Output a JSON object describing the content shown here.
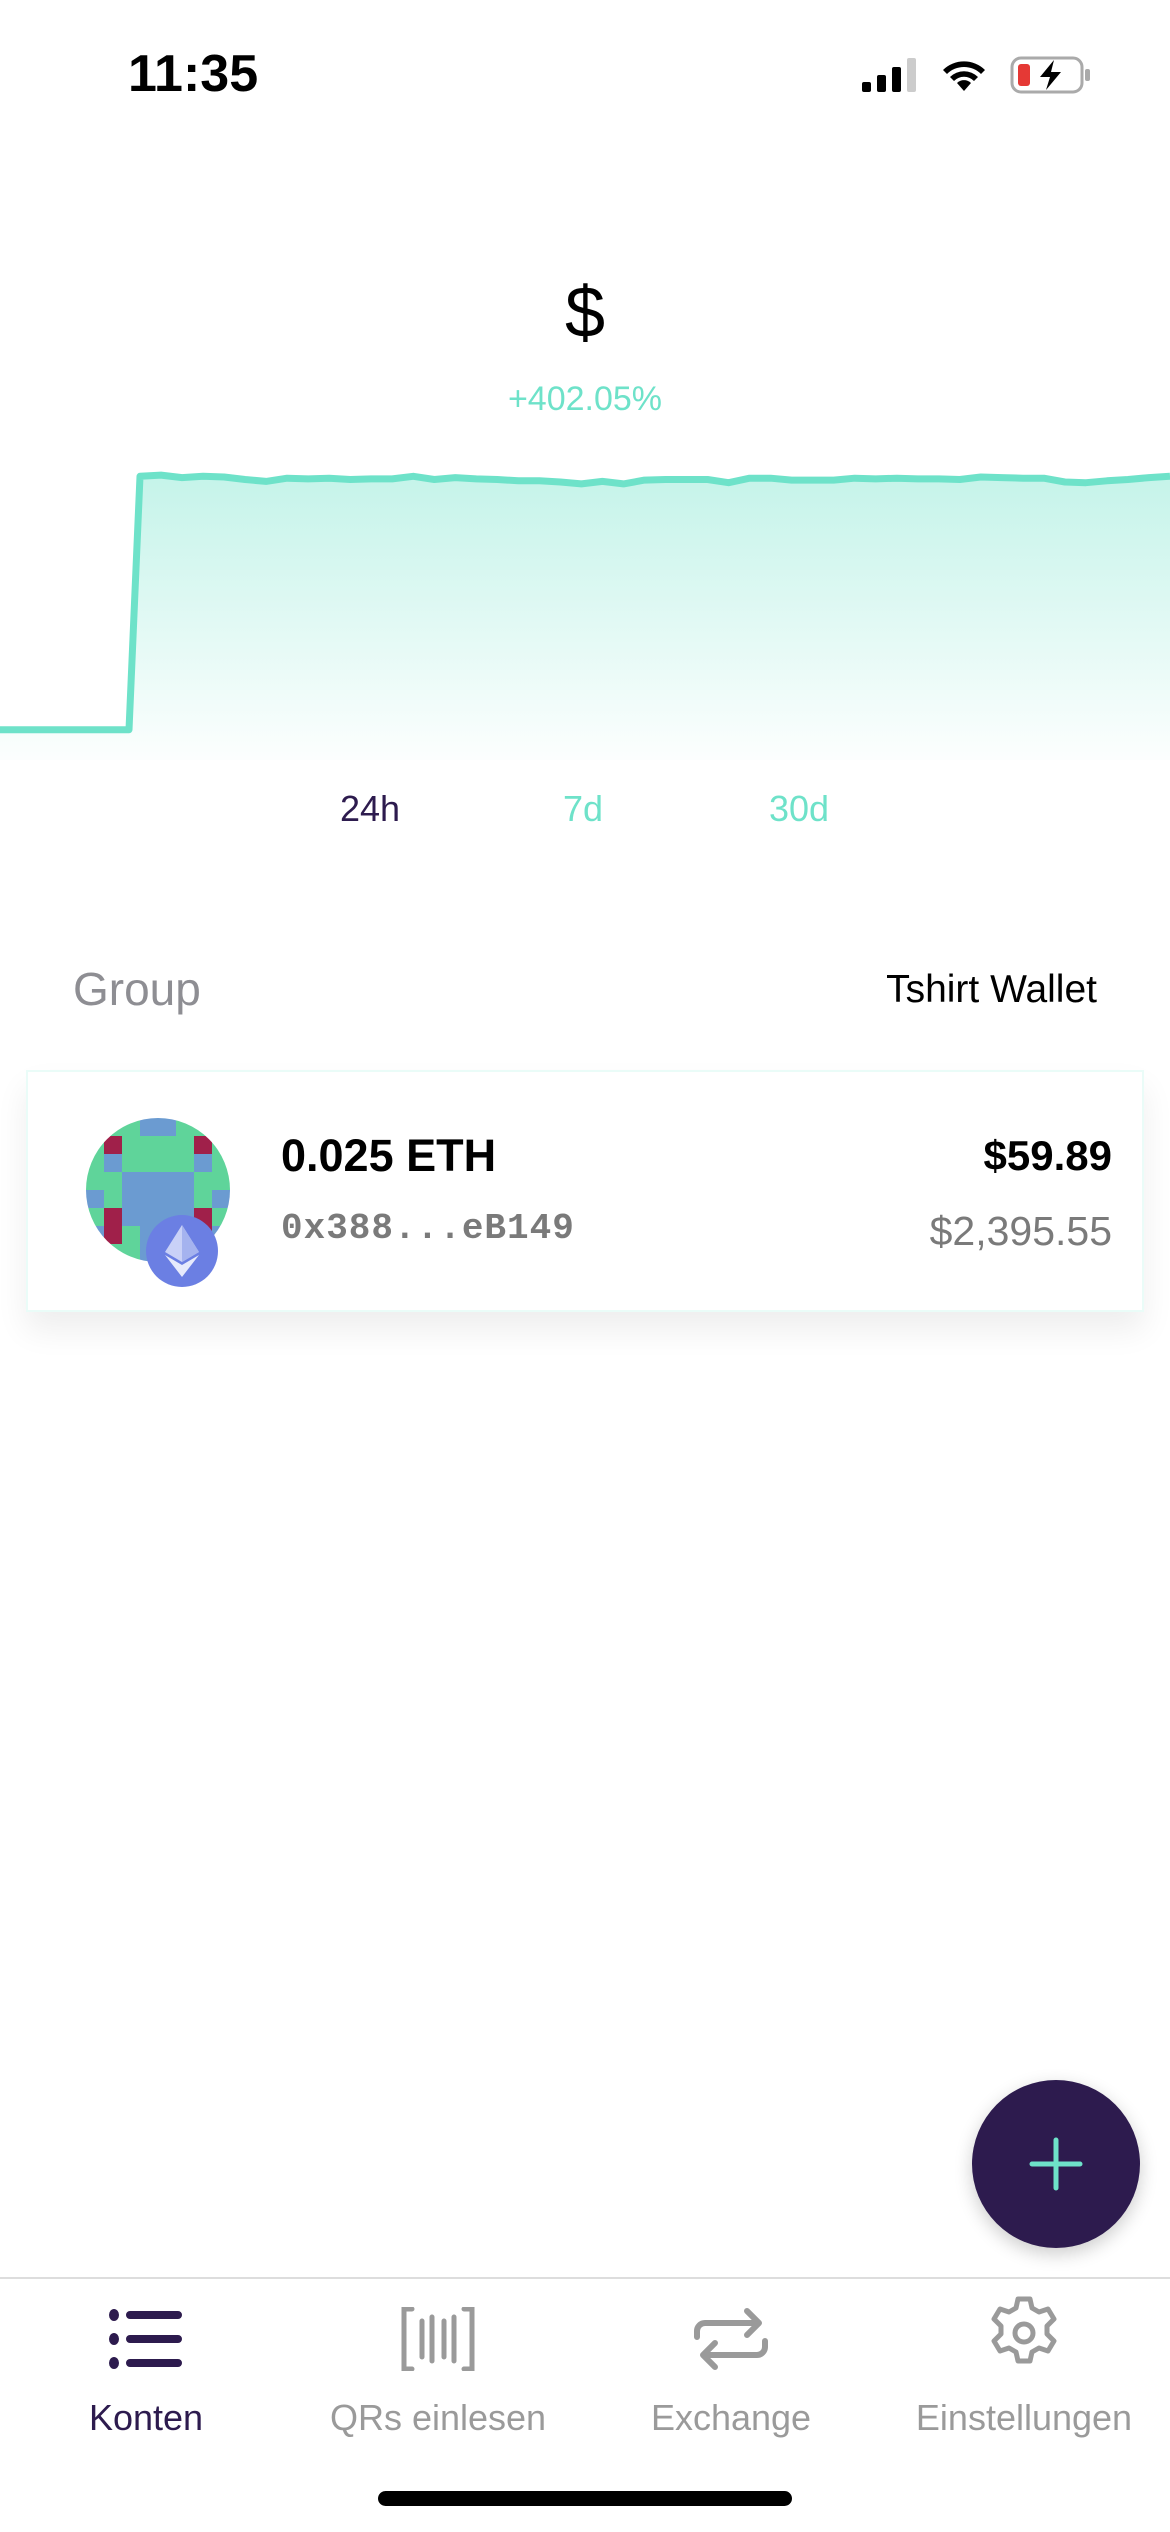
{
  "status_bar": {
    "time": "11:35"
  },
  "header": {
    "balance": "$",
    "change": "+402.05%"
  },
  "chart_data": {
    "type": "area",
    "title": "",
    "values": [
      1.0,
      1.0,
      1.0,
      1.0,
      1.0,
      1.0,
      1.0,
      5.0,
      5.02,
      4.98,
      5.0,
      4.99,
      4.95,
      4.92,
      4.97,
      4.96,
      4.97,
      4.95,
      4.96,
      4.96,
      5.0,
      4.95,
      4.98,
      4.96,
      4.95,
      4.93,
      4.93,
      4.91,
      4.88,
      4.92,
      4.88,
      4.94,
      4.95,
      4.95,
      4.95,
      4.9,
      4.97,
      4.97,
      4.94,
      4.94,
      4.94,
      4.97,
      4.96,
      4.97,
      4.96,
      4.96,
      4.95,
      4.99,
      4.98,
      4.97,
      4.97,
      4.91,
      4.9,
      4.93,
      4.95,
      4.98,
      5.0
    ],
    "ylim": [
      0.6,
      5.1
    ],
    "line_color": "#6ee2c9",
    "ranges": [
      "24h",
      "7d",
      "30d"
    ],
    "active_range": "24h"
  },
  "group": {
    "label": "Group",
    "wallet_name": "Tshirt Wallet"
  },
  "account": {
    "amount": "0.025 ETH",
    "address": "0x388...eB149",
    "fiat_value": "$59.89",
    "price": "$2,395.55"
  },
  "tabs": [
    {
      "label": "Konten"
    },
    {
      "label": "QRs einlesen"
    },
    {
      "label": "Exchange"
    },
    {
      "label": "Einstellungen"
    }
  ],
  "colors": {
    "accent": "#6ee2c9",
    "primary": "#2d1b4e"
  }
}
